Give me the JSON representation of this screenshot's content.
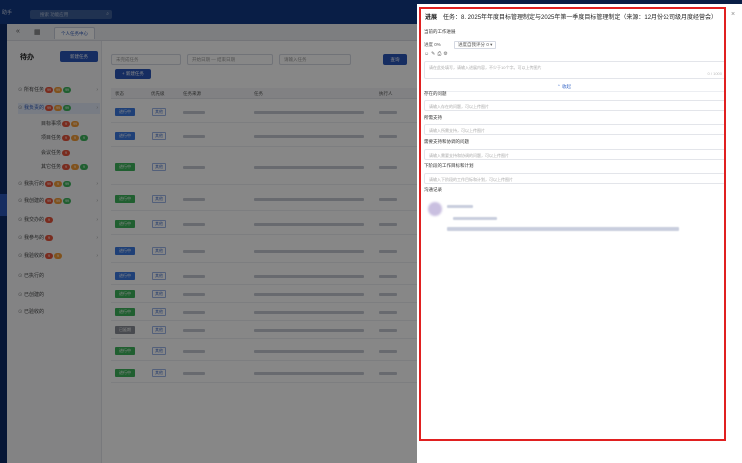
{
  "topbar": {
    "app_name": "助手",
    "search_placeholder": "搜索  功能应用"
  },
  "tabs": {
    "active_tab": "个人任务中心"
  },
  "sidebar": {
    "title": "待办",
    "create_button": "新建任务",
    "items": [
      {
        "label": "所有任务",
        "badges": [
          "99",
          "99",
          "99"
        ]
      },
      {
        "label": "我负责的",
        "badges": [
          "99",
          "99",
          "99"
        ]
      },
      {
        "label": "目标事项",
        "badges": [
          "9",
          "99"
        ]
      },
      {
        "label": "项目任务",
        "badges": [
          "9",
          "9",
          "9"
        ]
      },
      {
        "label": "会议任务",
        "badges": [
          "9"
        ]
      },
      {
        "label": "其它任务",
        "badges": [
          "9",
          "9",
          "9"
        ]
      },
      {
        "label": "我执行的",
        "badges": [
          "99",
          "9",
          "99"
        ]
      },
      {
        "label": "我创建的",
        "badges": [
          "99",
          "99",
          "99"
        ]
      },
      {
        "label": "我交办的",
        "badges": [
          "9"
        ]
      },
      {
        "label": "我参与的",
        "badges": [
          "9"
        ]
      },
      {
        "label": "我验收的",
        "badges": [
          "9",
          "9"
        ]
      },
      {
        "label": "已执行的",
        "badges": []
      },
      {
        "label": "已创建的",
        "badges": []
      },
      {
        "label": "已验收的",
        "badges": []
      }
    ]
  },
  "main": {
    "filter_status": "未完成任务",
    "filter_date": "开始日期  —  结束日期",
    "filter_keyword": "请输入任务",
    "search_button": "查询",
    "add_button": "+ 新建任务",
    "columns": [
      "状态",
      "优先级",
      "任务来源",
      "任务",
      "执行人"
    ],
    "rows": [
      {
        "status": "进行中",
        "status_color": "blue",
        "priority": "其他"
      },
      {
        "status": "进行中",
        "status_color": "blue",
        "priority": "其他"
      },
      {
        "status": "进行中",
        "status_color": "green",
        "priority": "其他"
      },
      {
        "status": "进行中",
        "status_color": "green",
        "priority": "其他"
      },
      {
        "status": "进行中",
        "status_color": "green",
        "priority": "其他"
      },
      {
        "status": "进行中",
        "status_color": "blue",
        "priority": "其他"
      },
      {
        "status": "进行中",
        "status_color": "blue",
        "priority": "其他"
      },
      {
        "status": "进行中",
        "status_color": "green",
        "priority": "其他"
      },
      {
        "status": "进行中",
        "status_color": "green",
        "priority": "其他"
      },
      {
        "status": "已延期",
        "status_color": "grey",
        "priority": "其他"
      },
      {
        "status": "进行中",
        "status_color": "green",
        "priority": "其他"
      },
      {
        "status": "进行中",
        "status_color": "green",
        "priority": "其他"
      }
    ]
  },
  "drawer": {
    "kind": "进展",
    "title": "任务：8. 2025年年度目标管理制定与2025年第一季度目标管理制定（来源：12月份公司级月度经营会）",
    "current_work_label": "当前的工作进展",
    "progress_label": "进度",
    "progress_value": "0%",
    "self_eval_label": "进度自我评分",
    "self_eval_value": "0",
    "work_placeholder": "请在此处填写，请输入进展内容，不少于10个字。可以上传图片",
    "work_count": "0 / 1000",
    "collapse_link": "收起",
    "issues_label": "存在的问题",
    "issues_placeholder": "请输入存在的问题，可以上传图片",
    "needs_label": "所需支持",
    "needs_placeholder": "请输入所需支持，可以上传图片",
    "coord_label": "需要支持和协调的问题",
    "coord_placeholder": "请输入需要支持和协调的问题，可以上传图片",
    "plan_label": "下阶段的工作目标和计划",
    "plan_placeholder": "请输入下阶段的工作目标和计划，可以上传图片",
    "log_label": "沟通记录",
    "colors": {
      "highlight": "#e02020",
      "primary": "#2a56b8"
    }
  }
}
